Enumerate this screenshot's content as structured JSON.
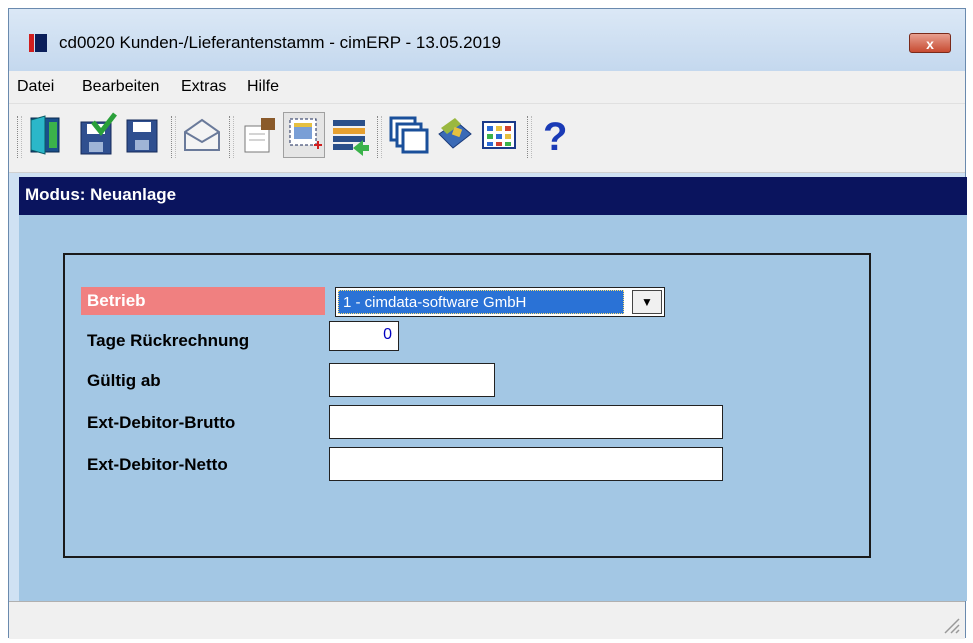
{
  "window": {
    "title": "cd0020 Kunden-/Lieferantenstamm - cimERP - 13.05.2019",
    "close_label": "x"
  },
  "menu": {
    "items": [
      {
        "label": "Datei"
      },
      {
        "label": "Bearbeiten"
      },
      {
        "label": "Extras"
      },
      {
        "label": "Hilfe"
      }
    ]
  },
  "toolbar": {
    "buttons": [
      "exit-door-icon",
      "save-check-icon",
      "save-icon",
      "mail-icon",
      "edit-hand-icon",
      "new-record-icon",
      "list-transfer-icon",
      "windows-icon",
      "book-tag-icon",
      "grid-icon",
      "help-icon"
    ]
  },
  "mode": {
    "text": "Modus: Neuanlage"
  },
  "form": {
    "betrieb_label": "Betrieb",
    "betrieb_value": "1 - cimdata-software GmbH",
    "tage_label": "Tage Rückrechnung",
    "tage_value": "0",
    "gueltig_label": "Gültig ab",
    "gueltig_value": "",
    "brutto_label": "Ext-Debitor-Brutto",
    "brutto_value": "",
    "netto_label": "Ext-Debitor-Netto",
    "netto_value": ""
  },
  "colors": {
    "mode_bar": "#0a145e",
    "content_bg": "#a3c7e4",
    "required_label_bg": "#f08080",
    "selection": "#2a72d6"
  }
}
